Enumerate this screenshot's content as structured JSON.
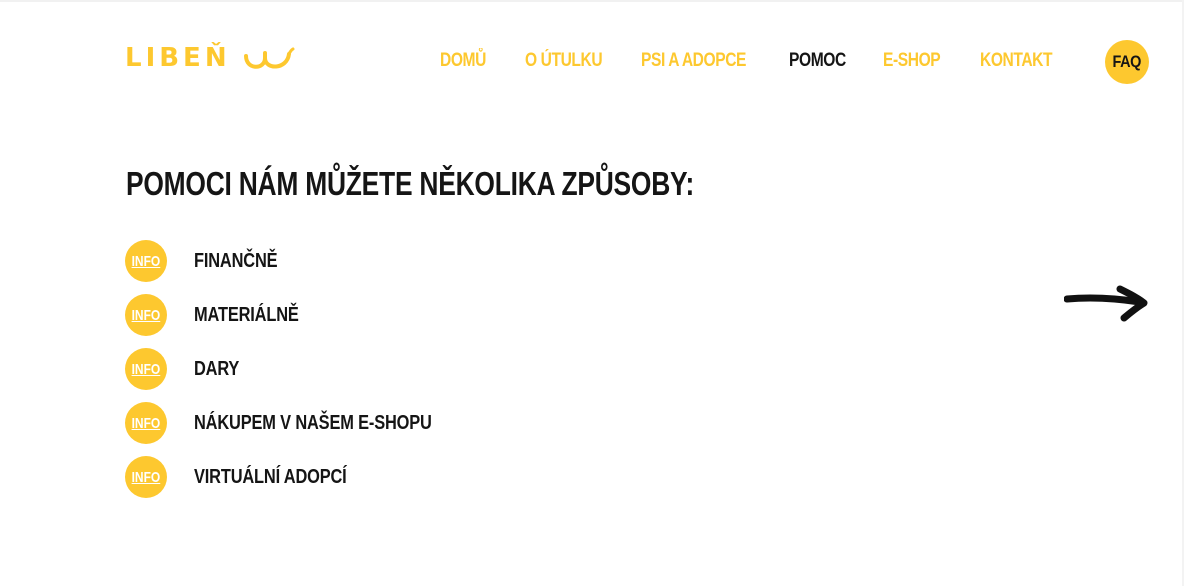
{
  "brand": {
    "name": "LIBEŇ",
    "color": "#fdc82f"
  },
  "nav": {
    "items": [
      {
        "label": "DOMŮ",
        "active": false
      },
      {
        "label": "O ÚTULKU",
        "active": false
      },
      {
        "label": "PSI A ADOPCE",
        "active": false
      },
      {
        "label": "POMOC",
        "active": true
      },
      {
        "label": "E-SHOP",
        "active": false
      },
      {
        "label": "KONTAKT",
        "active": false
      }
    ],
    "faq_label": "FAQ"
  },
  "main": {
    "heading": "POMOCI NÁM MŮŽETE NĚKOLIKA ZPŮSOBY:",
    "badge_label": "INFO",
    "items": [
      {
        "label": "FINANČNĚ"
      },
      {
        "label": "MATERIÁLNĚ"
      },
      {
        "label": "DARY"
      },
      {
        "label": "NÁKUPEM V NAŠEM E-SHOPU"
      },
      {
        "label": "VIRTUÁLNÍ ADOPCÍ"
      }
    ]
  },
  "icons": {
    "logo_mark": "cat-whiskers-icon",
    "scroll_arrow": "arrow-right-icon"
  },
  "colors": {
    "accent": "#fdc82f",
    "text": "#151515",
    "background": "#ffffff"
  }
}
